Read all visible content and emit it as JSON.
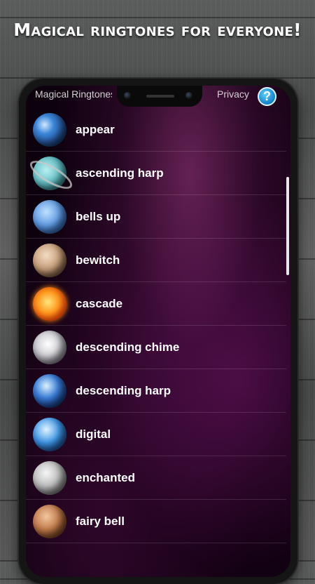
{
  "promo": {
    "title": "Magical ringtones for everyone!"
  },
  "header": {
    "app_title": "Magical Ringtones",
    "privacy_label": "Privacy",
    "help_label": "?"
  },
  "ringtones": [
    {
      "label": "appear",
      "icon": "earth-icon"
    },
    {
      "label": "ascending harp",
      "icon": "uranus-icon"
    },
    {
      "label": "bells up",
      "icon": "neptune-icon"
    },
    {
      "label": "bewitch",
      "icon": "venus-icon"
    },
    {
      "label": "cascade",
      "icon": "sun-icon"
    },
    {
      "label": "descending chime",
      "icon": "pale-planet-icon"
    },
    {
      "label": "descending harp",
      "icon": "blue-planet-icon"
    },
    {
      "label": "digital",
      "icon": "digital-planet-icon"
    },
    {
      "label": "enchanted",
      "icon": "moon-icon"
    },
    {
      "label": "fairy bell",
      "icon": "mars-icon"
    }
  ]
}
